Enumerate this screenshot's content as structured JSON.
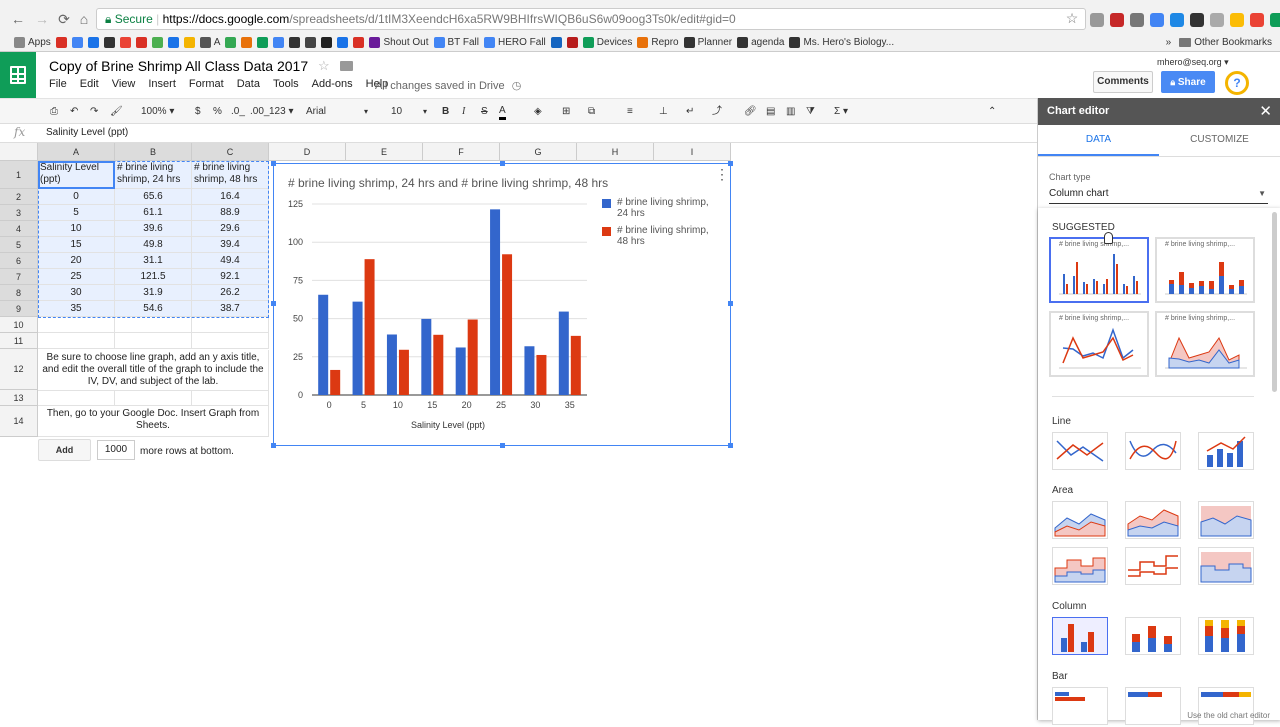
{
  "browser": {
    "secure_label": "Secure",
    "url_host": "https://docs.google.com",
    "url_path": "/spreadsheets/d/1tIM3XeendcH6xa5RW9BHIfrsWIQB6uS6w09oog3Ts0k/edit#gid=0",
    "bookmarks": [
      {
        "label": "Apps",
        "color": "#888"
      },
      {
        "label": "",
        "color": "#d93025"
      },
      {
        "label": "",
        "color": "#4285f4"
      },
      {
        "label": "",
        "color": "#1a73e8"
      },
      {
        "label": "",
        "color": "#333"
      },
      {
        "label": "",
        "color": "#ea4335"
      },
      {
        "label": "",
        "color": "#d93025"
      },
      {
        "label": "",
        "color": "#4caf50"
      },
      {
        "label": "",
        "color": "#1a73e8"
      },
      {
        "label": "",
        "color": "#f4b400"
      },
      {
        "label": "A",
        "color": "#555"
      },
      {
        "label": "",
        "color": "#34a853"
      },
      {
        "label": "",
        "color": "#e8710a"
      },
      {
        "label": "",
        "color": "#0f9d58"
      },
      {
        "label": "",
        "color": "#4285f4"
      },
      {
        "label": "",
        "color": "#333"
      },
      {
        "label": "",
        "color": "#444"
      },
      {
        "label": "",
        "color": "#222"
      },
      {
        "label": "",
        "color": "#1a73e8"
      },
      {
        "label": "",
        "color": "#d93025"
      },
      {
        "label": "Shout Out",
        "color": "#6a1b9a"
      },
      {
        "label": "BT Fall",
        "color": "#4285f4"
      },
      {
        "label": "HERO Fall",
        "color": "#4285f4"
      },
      {
        "label": "",
        "color": "#1565c0"
      },
      {
        "label": "",
        "color": "#b71c1c"
      },
      {
        "label": "Devices",
        "color": "#0f9d58"
      },
      {
        "label": "Repro",
        "color": "#e8710a"
      },
      {
        "label": "Planner",
        "color": "#333"
      },
      {
        "label": "agenda",
        "color": "#333"
      },
      {
        "label": "Ms. Hero's Biology...",
        "color": "#333"
      }
    ],
    "more_label": "»",
    "other_bookmarks": "Other Bookmarks"
  },
  "header": {
    "doc_title": "Copy of Brine Shrimp All Class Data 2017",
    "menu": [
      "File",
      "Edit",
      "View",
      "Insert",
      "Format",
      "Data",
      "Tools",
      "Add-ons",
      "Help"
    ],
    "saved_status": "All changes saved in Drive",
    "user_email": "mhero@seq.org",
    "comments_label": "Comments",
    "share_label": "Share",
    "help_glyph": "?"
  },
  "toolbar": {
    "zoom": "100%",
    "currency": "$",
    "percent": "%",
    "dec_less": ".0_",
    "dec_more": ".00_",
    "format_more": "123",
    "font": "Arial",
    "font_size": "10",
    "bold": "B",
    "italic": "I",
    "strike": "S",
    "text_color": "A"
  },
  "formula_bar": {
    "fx": "fx",
    "value": "Salinity Level (ppt)"
  },
  "columns": [
    "A",
    "B",
    "C",
    "D",
    "E",
    "F",
    "G",
    "H",
    "I"
  ],
  "rows": [
    "1",
    "2",
    "3",
    "4",
    "5",
    "6",
    "7",
    "8",
    "9",
    "10",
    "11",
    "12",
    "13",
    "14"
  ],
  "table": {
    "headers": [
      "Salinity Level (ppt)",
      "# brine living shrimp,  24 hrs",
      "# brine living shrimp,  48 hrs"
    ],
    "data": [
      [
        "0",
        "65.6",
        "16.4"
      ],
      [
        "5",
        "61.1",
        "88.9"
      ],
      [
        "10",
        "39.6",
        "29.6"
      ],
      [
        "15",
        "49.8",
        "39.4"
      ],
      [
        "20",
        "31.1",
        "49.4"
      ],
      [
        "25",
        "121.5",
        "92.1"
      ],
      [
        "30",
        "31.9",
        "26.2"
      ],
      [
        "35",
        "54.6",
        "38.7"
      ]
    ]
  },
  "notes": {
    "row12": "Be sure to choose line graph, add an y axis title, and edit the overall title of the graph to include the IV, DV, and subject of the lab.",
    "row14": "Then, go to your Google Doc.  Insert Graph from Sheets."
  },
  "add_rows": {
    "button": "Add",
    "count": "1000",
    "label": "more rows at bottom."
  },
  "chart_data": {
    "type": "bar",
    "title": "# brine living shrimp,  24 hrs and # brine living shrimp,  48 hrs",
    "xlabel": "Salinity Level (ppt)",
    "ylabel": "",
    "categories": [
      "0",
      "5",
      "10",
      "15",
      "20",
      "25",
      "30",
      "35"
    ],
    "series": [
      {
        "name": "# brine living shrimp,  24 hrs",
        "color": "#3366cc",
        "values": [
          65.6,
          61.1,
          39.6,
          49.8,
          31.1,
          121.5,
          31.9,
          54.6
        ]
      },
      {
        "name": "# brine living shrimp,  48 hrs",
        "color": "#dc3912",
        "values": [
          16.4,
          88.9,
          29.6,
          39.4,
          49.4,
          92.1,
          26.2,
          38.7
        ]
      }
    ],
    "ylim": [
      0,
      125
    ],
    "yticks": [
      "0",
      "25",
      "50",
      "75",
      "100",
      "125"
    ],
    "grid": true,
    "legend": "right",
    "menu_glyph": "⋮"
  },
  "editor": {
    "title": "Chart editor",
    "close_glyph": "✕",
    "tabs": [
      "DATA",
      "CUSTOMIZE"
    ],
    "chart_type_label": "Chart type",
    "chart_type_value": "Column chart",
    "suggested_label": "SUGGESTED",
    "thumb_title": "# brine living shrimp,...",
    "categories": [
      "Line",
      "Area",
      "Column",
      "Bar"
    ],
    "old_editor_link": "Use the old chart editor"
  }
}
